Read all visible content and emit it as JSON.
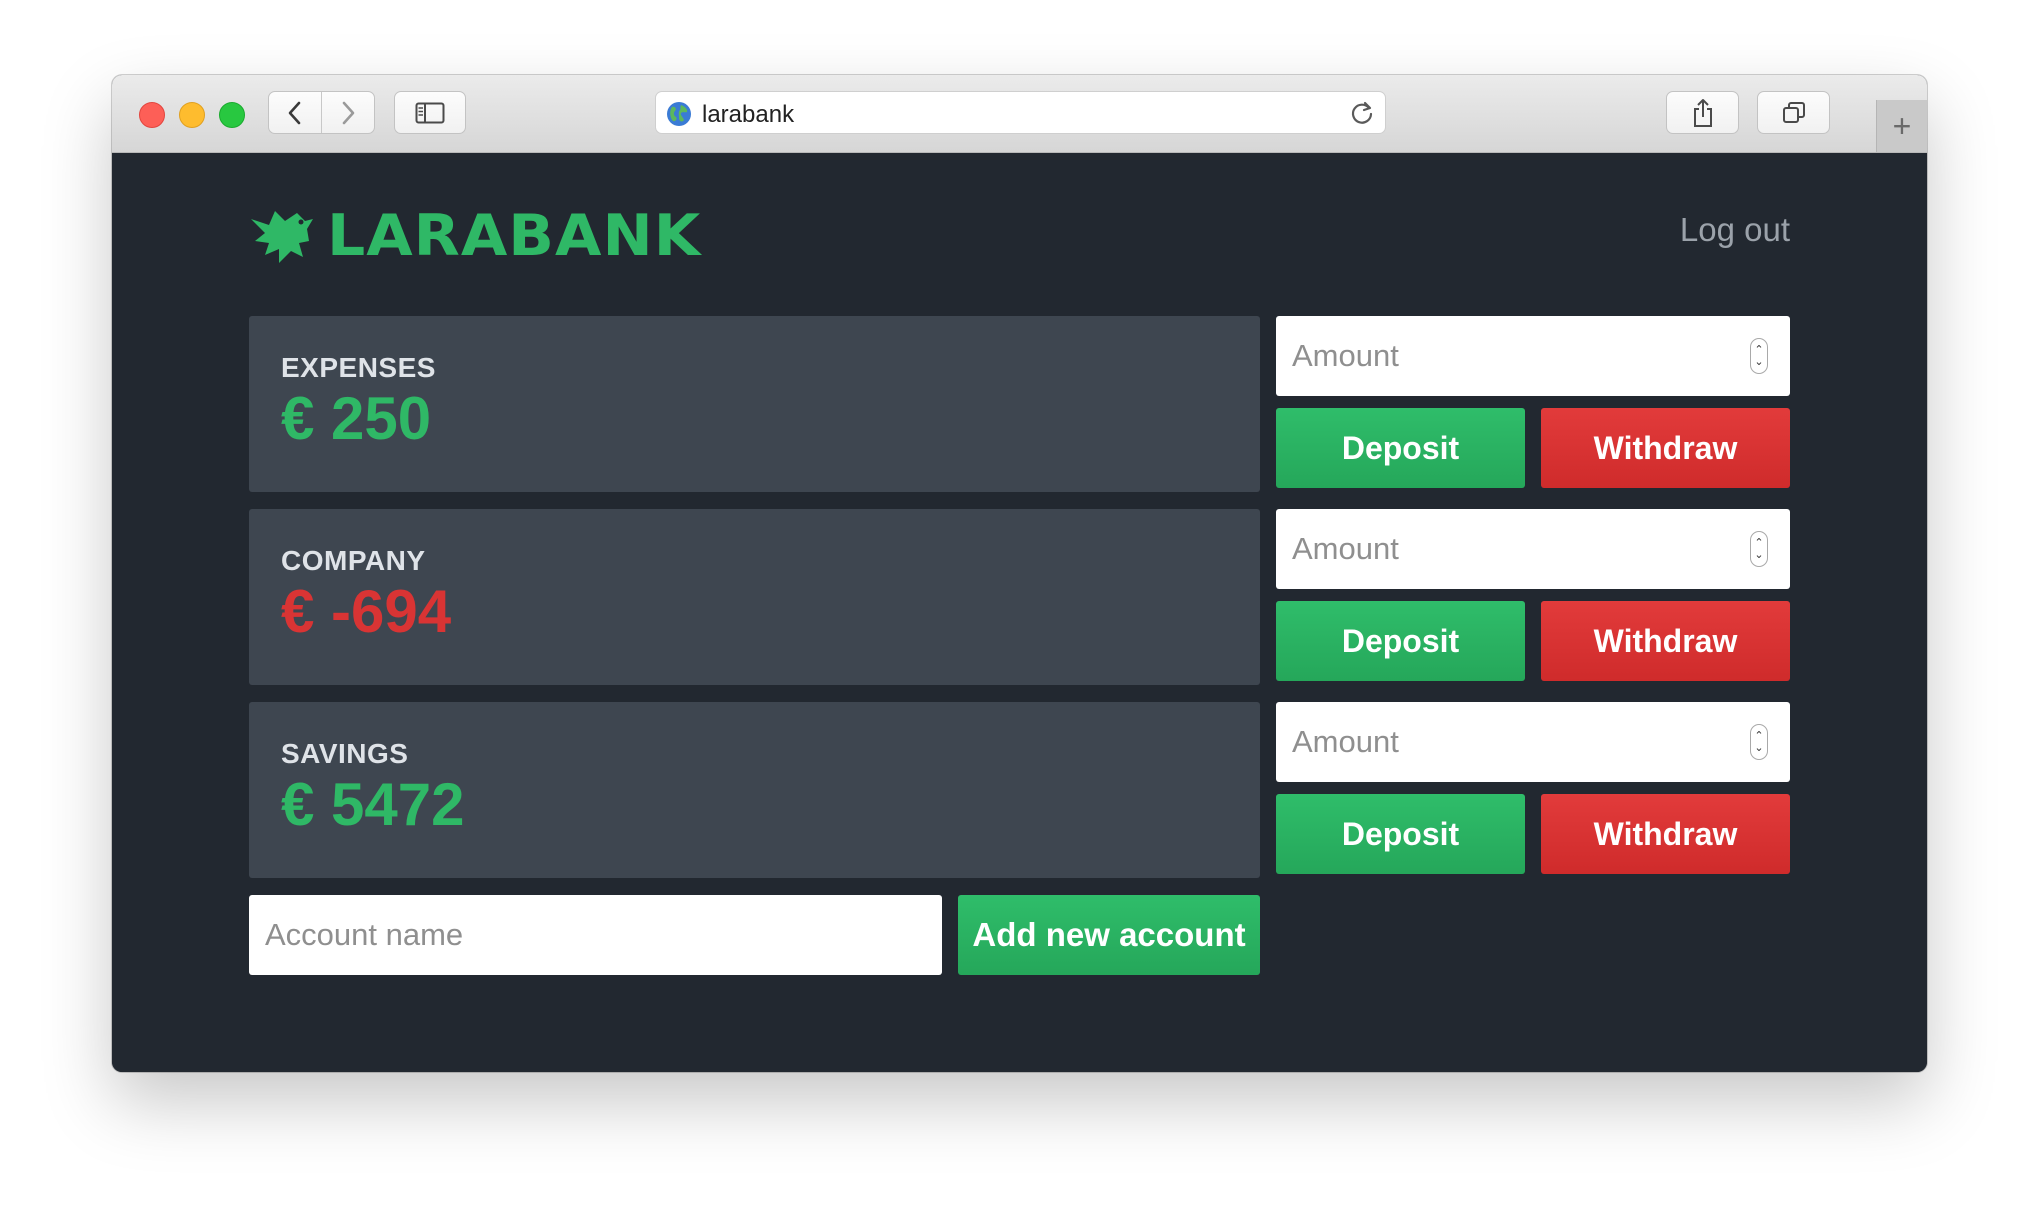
{
  "browser": {
    "url": "larabank",
    "icons": {
      "back": "chevron-left-icon",
      "forward": "chevron-right-icon",
      "sidebar": "sidebar-icon",
      "site": "globe-icon",
      "reload": "reload-icon",
      "share": "share-icon",
      "tabs": "tabs-icon",
      "new_tab": "plus-icon"
    },
    "new_tab_label": "+"
  },
  "app": {
    "brand": "LARABANK",
    "logout_label": "Log out",
    "colors": {
      "background": "#222830",
      "card": "#3e4650",
      "positive": "#2fb866",
      "negative": "#d93434",
      "deposit": "#2bb563",
      "withdraw": "#db3535"
    }
  },
  "accounts": [
    {
      "name": "EXPENSES",
      "balance": "€ 250",
      "status": "positive",
      "amount_placeholder": "Amount",
      "deposit_label": "Deposit",
      "withdraw_label": "Withdraw"
    },
    {
      "name": "COMPANY",
      "balance": "€ -694",
      "status": "negative",
      "amount_placeholder": "Amount",
      "deposit_label": "Deposit",
      "withdraw_label": "Withdraw"
    },
    {
      "name": "SAVINGS",
      "balance": "€ 5472",
      "status": "positive",
      "amount_placeholder": "Amount",
      "deposit_label": "Deposit",
      "withdraw_label": "Withdraw"
    }
  ],
  "new_account": {
    "placeholder": "Account name",
    "button_label": "Add new account"
  }
}
